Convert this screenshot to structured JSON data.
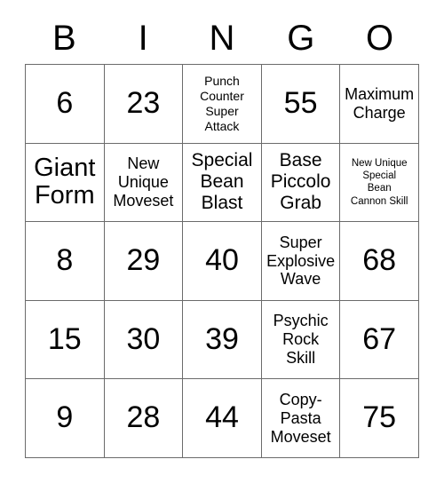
{
  "card": {
    "title": "BINGO",
    "headers": [
      "B",
      "I",
      "N",
      "G",
      "O"
    ],
    "rows": [
      [
        {
          "text": "6",
          "kind": "number",
          "size": "sz-number"
        },
        {
          "text": "23",
          "kind": "number",
          "size": "sz-number"
        },
        {
          "text": "Punch\nCounter\nSuper\nAttack",
          "kind": "text",
          "size": "sz-sm"
        },
        {
          "text": "55",
          "kind": "number",
          "size": "sz-number"
        },
        {
          "text": "Maximum\nCharge",
          "kind": "text",
          "size": "sz-md"
        }
      ],
      [
        {
          "text": "Giant\nForm",
          "kind": "text",
          "size": "sz-xl"
        },
        {
          "text": "New\nUnique\nMoveset",
          "kind": "text",
          "size": "sz-md"
        },
        {
          "text": "Special\nBean\nBlast",
          "kind": "text",
          "size": "sz-lg"
        },
        {
          "text": "Base\nPiccolo\nGrab",
          "kind": "text",
          "size": "sz-lg"
        },
        {
          "text": "New Unique\nSpecial\nBean\nCannon Skill",
          "kind": "text",
          "size": "sz-xs"
        }
      ],
      [
        {
          "text": "8",
          "kind": "number",
          "size": "sz-number"
        },
        {
          "text": "29",
          "kind": "number",
          "size": "sz-number"
        },
        {
          "text": "40",
          "kind": "number",
          "size": "sz-number"
        },
        {
          "text": "Super\nExplosive\nWave",
          "kind": "text",
          "size": "sz-md"
        },
        {
          "text": "68",
          "kind": "number",
          "size": "sz-number"
        }
      ],
      [
        {
          "text": "15",
          "kind": "number",
          "size": "sz-number"
        },
        {
          "text": "30",
          "kind": "number",
          "size": "sz-number"
        },
        {
          "text": "39",
          "kind": "number",
          "size": "sz-number"
        },
        {
          "text": "Psychic\nRock\nSkill",
          "kind": "text",
          "size": "sz-md"
        },
        {
          "text": "67",
          "kind": "number",
          "size": "sz-number"
        }
      ],
      [
        {
          "text": "9",
          "kind": "number",
          "size": "sz-number"
        },
        {
          "text": "28",
          "kind": "number",
          "size": "sz-number"
        },
        {
          "text": "44",
          "kind": "number",
          "size": "sz-number"
        },
        {
          "text": "Copy-\nPasta\nMoveset",
          "kind": "text",
          "size": "sz-md"
        },
        {
          "text": "75",
          "kind": "number",
          "size": "sz-number"
        }
      ]
    ]
  },
  "colors": {
    "background": "#ffffff",
    "text": "#000000",
    "grid_line": "#6b6b6b"
  }
}
